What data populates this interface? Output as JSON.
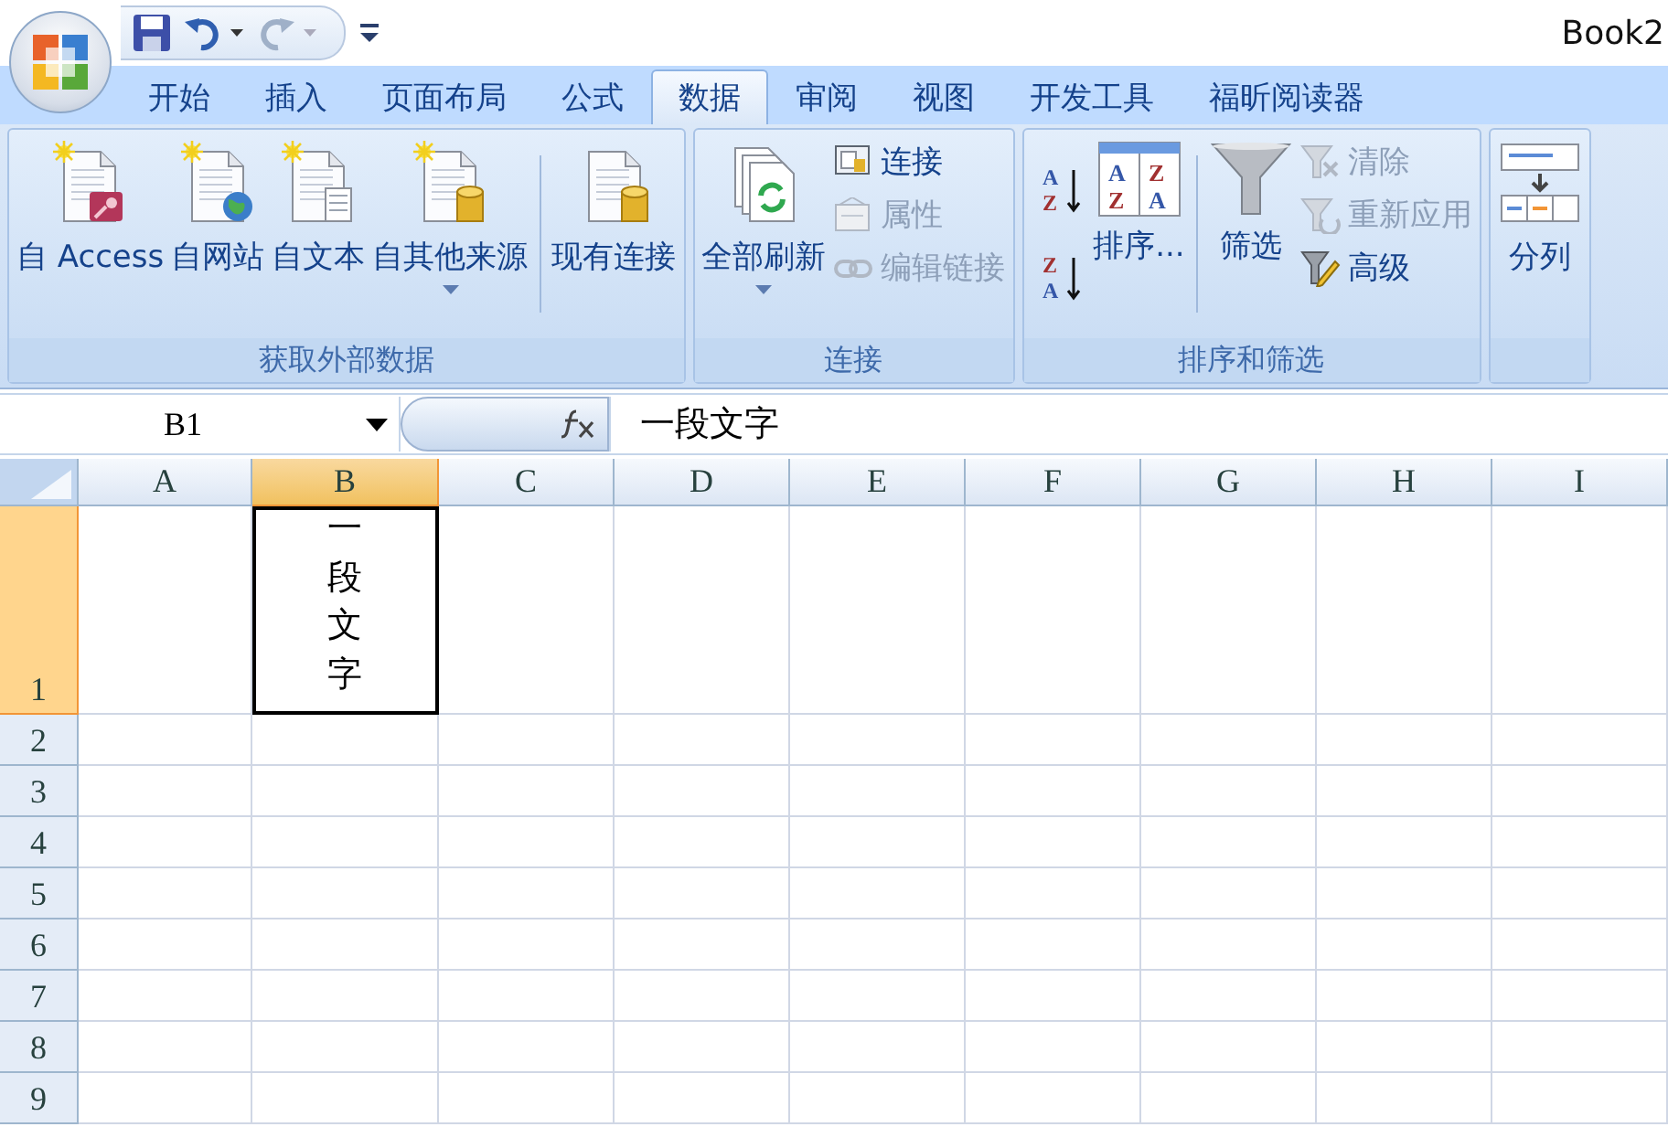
{
  "title_bar": {
    "title": "Book2"
  },
  "tabs": [
    {
      "label": "开始",
      "selected": false
    },
    {
      "label": "插入",
      "selected": false
    },
    {
      "label": "页面布局",
      "selected": false
    },
    {
      "label": "公式",
      "selected": false
    },
    {
      "label": "数据",
      "selected": true
    },
    {
      "label": "审阅",
      "selected": false
    },
    {
      "label": "视图",
      "selected": false
    },
    {
      "label": "开发工具",
      "selected": false
    },
    {
      "label": "福昕阅读器",
      "selected": false
    }
  ],
  "ribbon_groups": [
    {
      "label": "获取外部数据",
      "items": [
        {
          "kind": "large",
          "label": "自 Access",
          "dropdown": false
        },
        {
          "kind": "large",
          "label": "自网站",
          "dropdown": false
        },
        {
          "kind": "large",
          "label": "自文本",
          "dropdown": false
        },
        {
          "kind": "large",
          "label": "自其他来源",
          "dropdown": true
        },
        {
          "kind": "separator"
        },
        {
          "kind": "large",
          "label": "现有连接",
          "dropdown": false
        }
      ]
    },
    {
      "label": "连接",
      "items": [
        {
          "kind": "large",
          "label": "全部刷新",
          "dropdown": true
        },
        {
          "kind": "stack",
          "items": [
            {
              "label": "连接",
              "disabled": false
            },
            {
              "label": "属性",
              "disabled": true
            },
            {
              "label": "编辑链接",
              "disabled": true
            }
          ]
        }
      ]
    },
    {
      "label": "排序和筛选",
      "items": [
        {
          "kind": "icons",
          "buttons": [
            {
              "top": "A",
              "bottom": "Z"
            },
            {
              "top": "Z",
              "bottom": "A"
            }
          ]
        },
        {
          "kind": "large",
          "label": "排序...",
          "dropdown": false,
          "icon_letters": [
            "A",
            "Z",
            "Z",
            "A"
          ]
        },
        {
          "kind": "separator"
        },
        {
          "kind": "large",
          "label": "筛选",
          "dropdown": false
        },
        {
          "kind": "stack",
          "items": [
            {
              "label": "清除",
              "disabled": true
            },
            {
              "label": "重新应用",
              "disabled": true
            },
            {
              "label": "高级",
              "disabled": false
            }
          ]
        }
      ]
    },
    {
      "items": [
        {
          "kind": "large",
          "label": "分列",
          "dropdown": false
        }
      ]
    }
  ],
  "formula_bar": {
    "name_box": "B1",
    "formula": "一段文字"
  },
  "sheet": {
    "columns": [
      {
        "label": "A",
        "selected": false
      },
      {
        "label": "B",
        "selected": true
      },
      {
        "label": "C",
        "selected": false
      },
      {
        "label": "D",
        "selected": false
      },
      {
        "label": "E",
        "selected": false
      },
      {
        "label": "F",
        "selected": false
      },
      {
        "label": "G",
        "selected": false
      },
      {
        "label": "H",
        "selected": false
      },
      {
        "label": "I",
        "selected": false
      }
    ],
    "rows": [
      {
        "label": "1",
        "selected": true,
        "cells": [
          {},
          {
            "text": "一段文字",
            "vertical": true,
            "selected": true
          }
        ]
      },
      {
        "label": "2",
        "selected": false
      },
      {
        "label": "3",
        "selected": false
      },
      {
        "label": "4",
        "selected": false
      },
      {
        "label": "5",
        "selected": false
      },
      {
        "label": "6",
        "selected": false
      },
      {
        "label": "7",
        "selected": false
      },
      {
        "label": "8",
        "selected": false
      },
      {
        "label": "9",
        "selected": false
      }
    ]
  }
}
